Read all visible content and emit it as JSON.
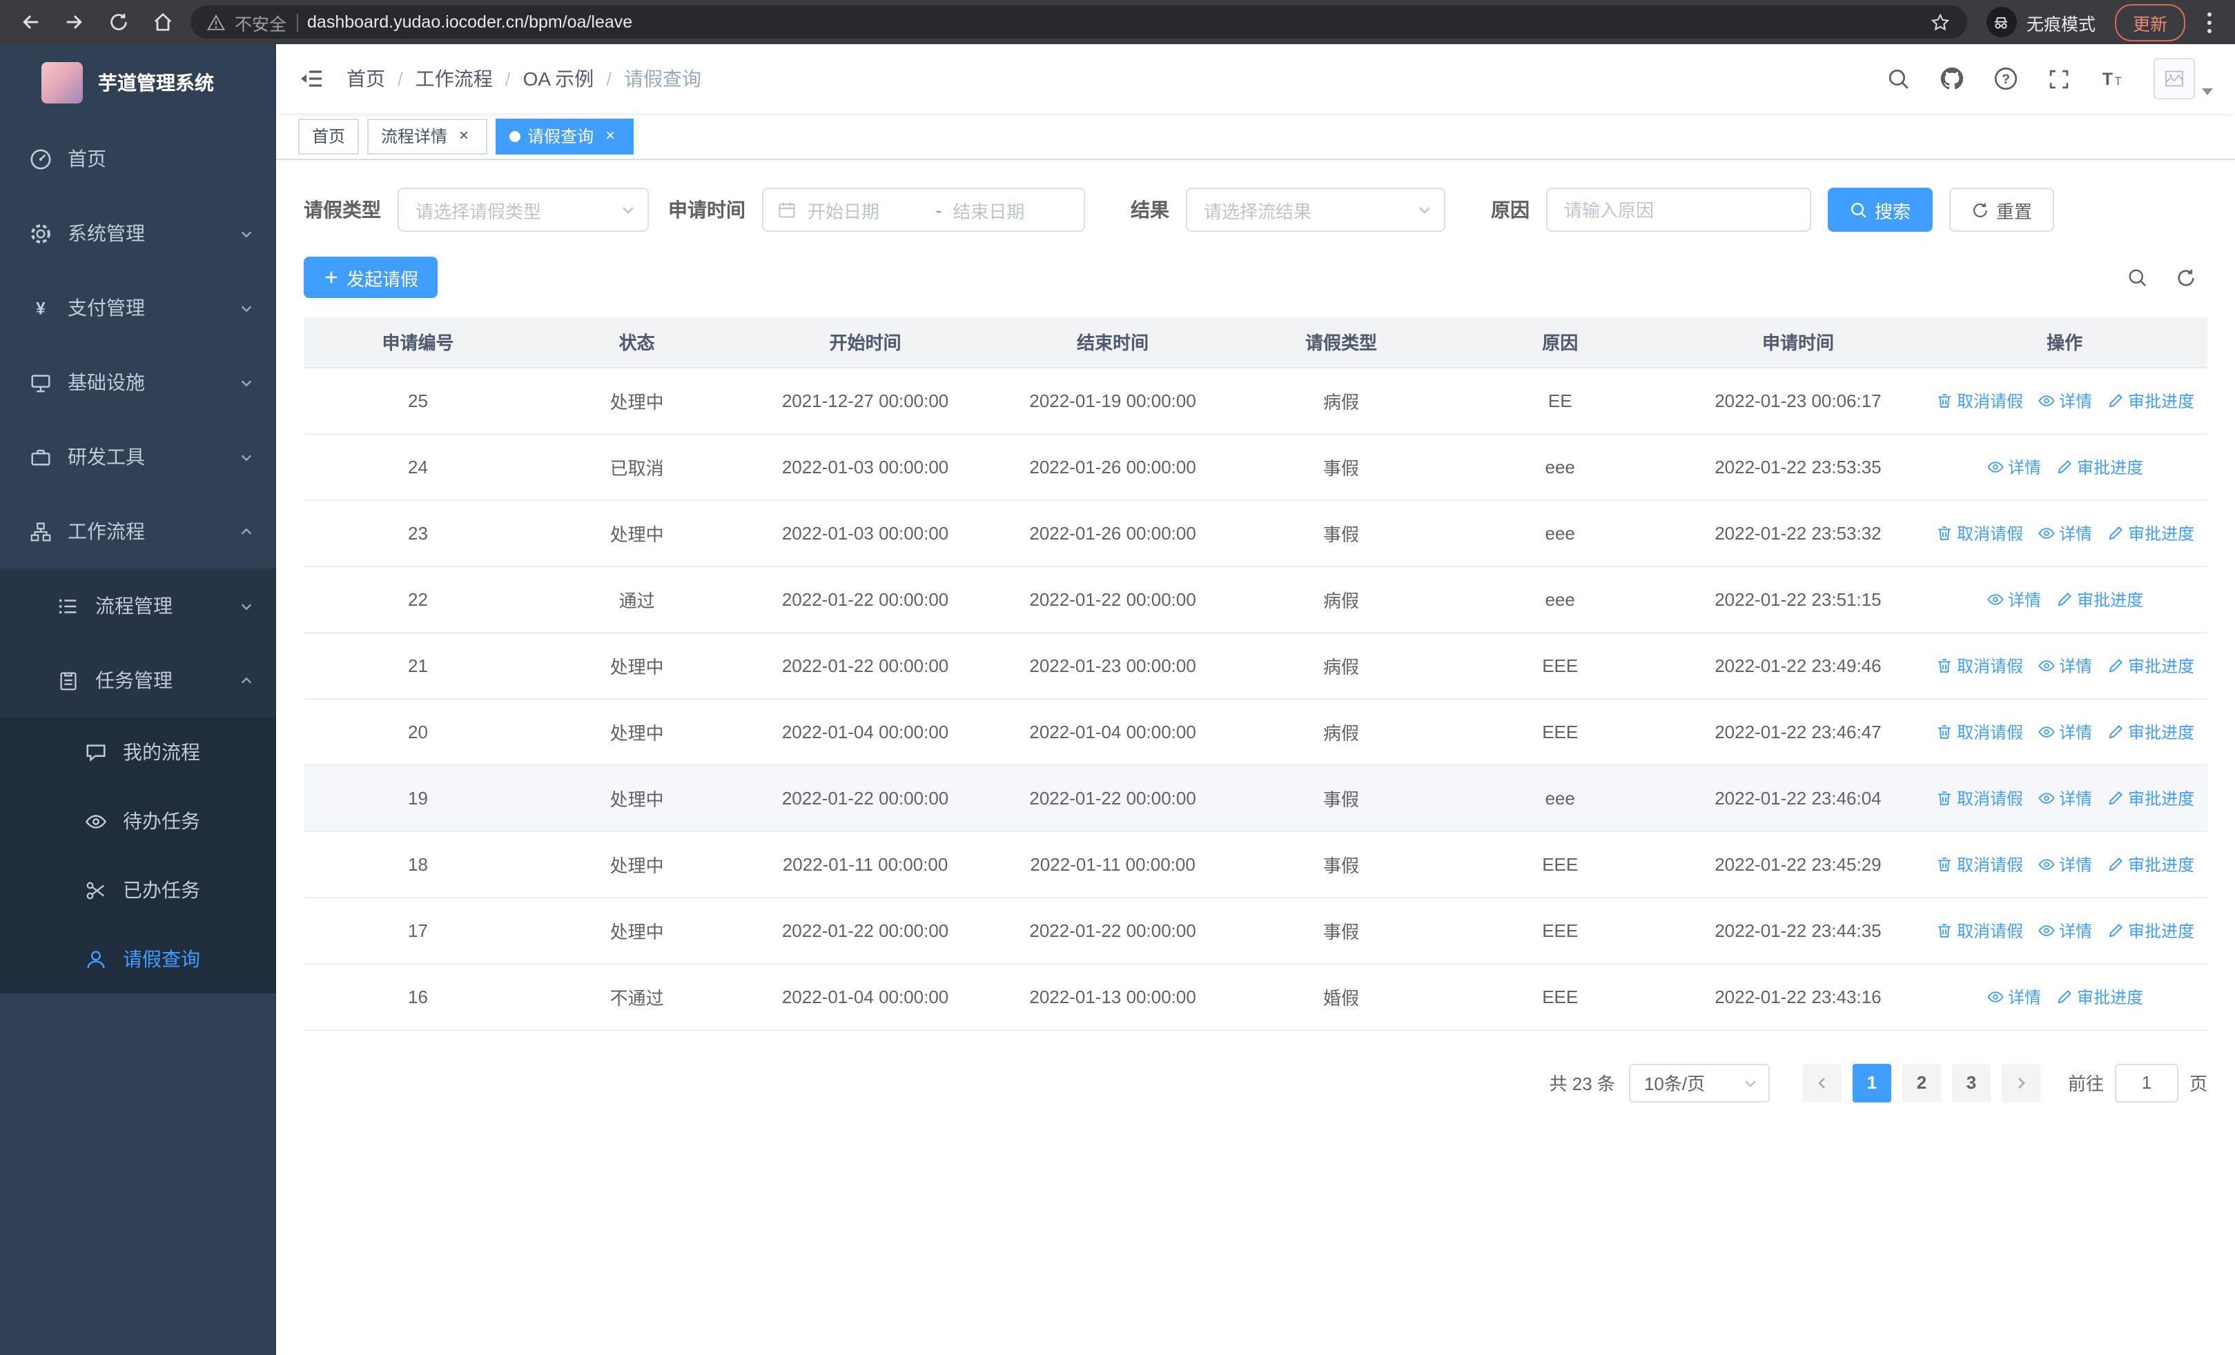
{
  "browser": {
    "security_label": "不安全",
    "url": "dashboard.yudao.iocoder.cn/bpm/oa/leave",
    "incognito_label": "无痕模式",
    "update_label": "更新"
  },
  "sidebar": {
    "app_title": "芋道管理系统",
    "items": [
      {
        "label": "首页"
      },
      {
        "label": "系统管理"
      },
      {
        "label": "支付管理"
      },
      {
        "label": "基础设施"
      },
      {
        "label": "研发工具"
      },
      {
        "label": "工作流程"
      },
      {
        "label": "流程管理"
      },
      {
        "label": "任务管理"
      },
      {
        "label": "我的流程"
      },
      {
        "label": "待办任务"
      },
      {
        "label": "已办任务"
      },
      {
        "label": "请假查询"
      }
    ]
  },
  "breadcrumb": [
    "首页",
    "工作流程",
    "OA 示例",
    "请假查询"
  ],
  "tabs": [
    {
      "label": "首页"
    },
    {
      "label": "流程详情"
    },
    {
      "label": "请假查询"
    }
  ],
  "filters": {
    "leave_type_label": "请假类型",
    "leave_type_placeholder": "请选择请假类型",
    "apply_time_label": "申请时间",
    "start_date_placeholder": "开始日期",
    "range_separator": "-",
    "end_date_placeholder": "结束日期",
    "result_label": "结果",
    "result_placeholder": "请选择流结果",
    "reason_label": "原因",
    "reason_placeholder": "请输入原因",
    "search_button": "搜索",
    "reset_button": "重置"
  },
  "toolbar": {
    "create_button": "发起请假"
  },
  "table": {
    "columns": [
      "申请编号",
      "状态",
      "开始时间",
      "结束时间",
      "请假类型",
      "原因",
      "申请时间",
      "操作"
    ],
    "op_labels": {
      "cancel": "取消请假",
      "detail": "详情",
      "progress": "审批进度"
    },
    "rows": [
      {
        "id": "25",
        "status": "处理中",
        "start": "2021-12-27 00:00:00",
        "end": "2022-01-19 00:00:00",
        "type": "病假",
        "reason": "EE",
        "applied": "2022-01-23 00:06:17",
        "ops": [
          "cancel",
          "detail",
          "progress"
        ],
        "highlighted": false
      },
      {
        "id": "24",
        "status": "已取消",
        "start": "2022-01-03 00:00:00",
        "end": "2022-01-26 00:00:00",
        "type": "事假",
        "reason": "eee",
        "applied": "2022-01-22 23:53:35",
        "ops": [
          "detail",
          "progress"
        ],
        "highlighted": false
      },
      {
        "id": "23",
        "status": "处理中",
        "start": "2022-01-03 00:00:00",
        "end": "2022-01-26 00:00:00",
        "type": "事假",
        "reason": "eee",
        "applied": "2022-01-22 23:53:32",
        "ops": [
          "cancel",
          "detail",
          "progress"
        ],
        "highlighted": false
      },
      {
        "id": "22",
        "status": "通过",
        "start": "2022-01-22 00:00:00",
        "end": "2022-01-22 00:00:00",
        "type": "病假",
        "reason": "eee",
        "applied": "2022-01-22 23:51:15",
        "ops": [
          "detail",
          "progress"
        ],
        "highlighted": false
      },
      {
        "id": "21",
        "status": "处理中",
        "start": "2022-01-22 00:00:00",
        "end": "2022-01-23 00:00:00",
        "type": "病假",
        "reason": "EEE",
        "applied": "2022-01-22 23:49:46",
        "ops": [
          "cancel",
          "detail",
          "progress"
        ],
        "highlighted": false
      },
      {
        "id": "20",
        "status": "处理中",
        "start": "2022-01-04 00:00:00",
        "end": "2022-01-04 00:00:00",
        "type": "病假",
        "reason": "EEE",
        "applied": "2022-01-22 23:46:47",
        "ops": [
          "cancel",
          "detail",
          "progress"
        ],
        "highlighted": false
      },
      {
        "id": "19",
        "status": "处理中",
        "start": "2022-01-22 00:00:00",
        "end": "2022-01-22 00:00:00",
        "type": "事假",
        "reason": "eee",
        "applied": "2022-01-22 23:46:04",
        "ops": [
          "cancel",
          "detail",
          "progress"
        ],
        "highlighted": true
      },
      {
        "id": "18",
        "status": "处理中",
        "start": "2022-01-11 00:00:00",
        "end": "2022-01-11 00:00:00",
        "type": "事假",
        "reason": "EEE",
        "applied": "2022-01-22 23:45:29",
        "ops": [
          "cancel",
          "detail",
          "progress"
        ],
        "highlighted": false
      },
      {
        "id": "17",
        "status": "处理中",
        "start": "2022-01-22 00:00:00",
        "end": "2022-01-22 00:00:00",
        "type": "事假",
        "reason": "EEE",
        "applied": "2022-01-22 23:44:35",
        "ops": [
          "cancel",
          "detail",
          "progress"
        ],
        "highlighted": false
      },
      {
        "id": "16",
        "status": "不通过",
        "start": "2022-01-04 00:00:00",
        "end": "2022-01-13 00:00:00",
        "type": "婚假",
        "reason": "EEE",
        "applied": "2022-01-22 23:43:16",
        "ops": [
          "detail",
          "progress"
        ],
        "highlighted": false
      }
    ]
  },
  "pagination": {
    "total_label": "共 23 条",
    "page_size": "10条/页",
    "pages": [
      "1",
      "2",
      "3"
    ],
    "goto_label": "前往",
    "goto_value": "1",
    "goto_suffix": "页"
  },
  "colors": {
    "accent": "#409eff",
    "sidebar": "#304156",
    "submenu": "#1f2d3d"
  }
}
